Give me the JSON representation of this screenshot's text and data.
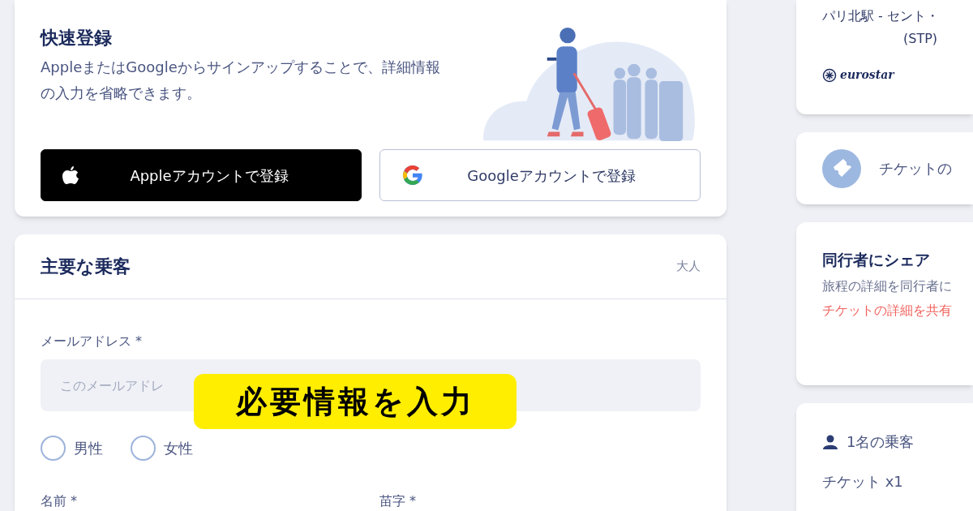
{
  "quick_signup": {
    "title": "快速登録",
    "description": "AppleまたはGoogleからサインアップすることで、詳細情報の入力を省略できます。",
    "buttons": [
      {
        "kind": "apple",
        "label": "Appleアカウントで登録"
      },
      {
        "kind": "google",
        "label": "Googleアカウントで登録"
      }
    ]
  },
  "main_passenger": {
    "title": "主要な乗客",
    "badge": "大人",
    "email": {
      "label": "メールアドレス *",
      "placeholder": "このメールアドレ"
    },
    "gender": [
      {
        "label": "男性",
        "selected": false
      },
      {
        "label": "女性",
        "selected": false
      }
    ],
    "name_fields": [
      {
        "label": "名前 *"
      },
      {
        "label": "苗字 *"
      }
    ]
  },
  "overlay_label": "必要情報を入力",
  "sidebar": {
    "route": {
      "stations": "パリ北駅 - セント・",
      "code": "(STP)",
      "operator": "eurostar"
    },
    "ticket_details": {
      "label": "チケットの"
    },
    "share": {
      "title": "同行者にシェア",
      "description": "旅程の詳細を同行者に",
      "link": "チケットの詳細を共有"
    },
    "summary": {
      "passengers": "1名の乗客",
      "tickets": "チケット x1"
    }
  }
}
